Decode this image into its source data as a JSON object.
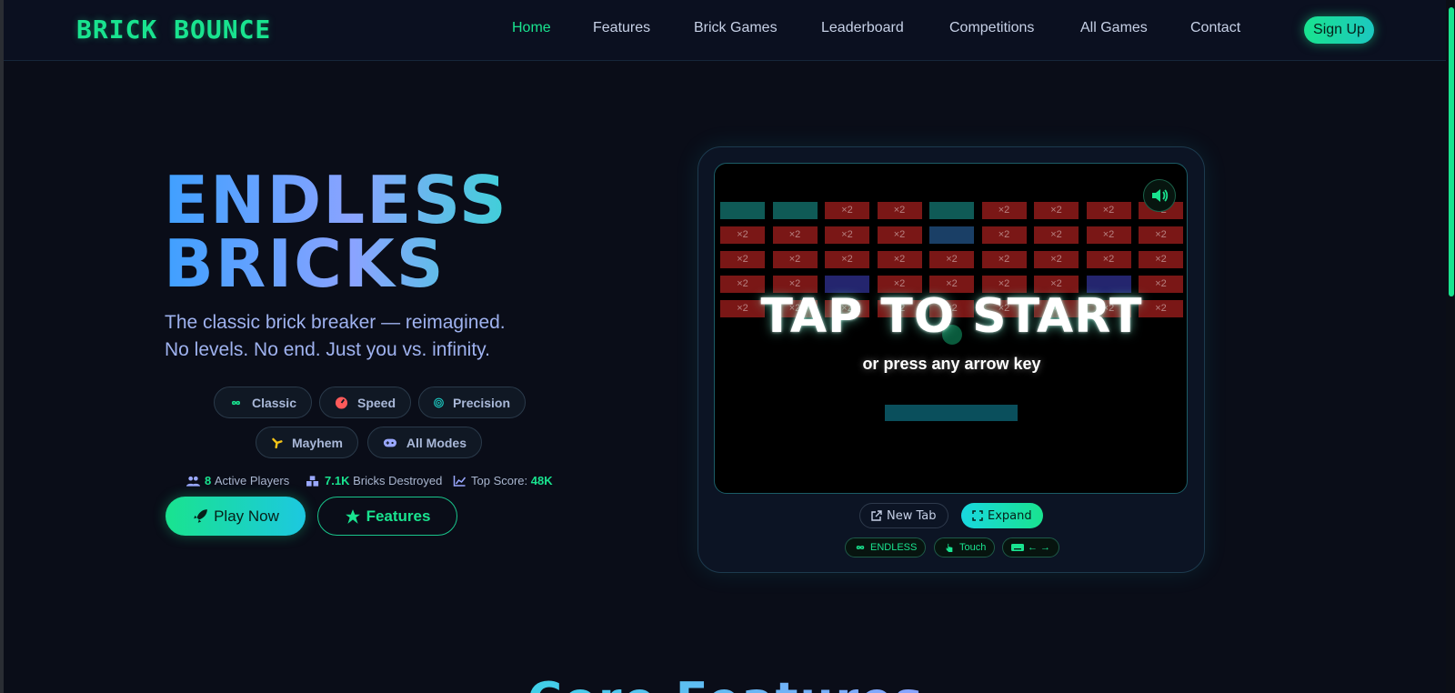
{
  "nav": {
    "brand": "BRICK BOUNCE",
    "links": [
      "Home",
      "Features",
      "Brick Games",
      "Leaderboard",
      "Competitions",
      "All Games",
      "Contact"
    ],
    "active": "Home",
    "signup": "Sign Up"
  },
  "hero": {
    "title_line1": "ENDLESS",
    "title_line2": "BRICKS",
    "subtitle_line1": "The classic brick breaker — reimagined.",
    "subtitle_line2": "No levels. No end. Just you vs. infinity.",
    "modes": [
      {
        "label": "Classic",
        "icon": "infinity-icon",
        "color": "#19e38f"
      },
      {
        "label": "Speed",
        "icon": "gauge-icon",
        "color": "#ff5a5a"
      },
      {
        "label": "Precision",
        "icon": "target-icon",
        "color": "#1cc8c0"
      },
      {
        "label": "Mayhem",
        "icon": "nuclear-icon",
        "color": "#f5c518"
      },
      {
        "label": "All Modes",
        "icon": "gamepad-icon",
        "color": "#9aa8ff"
      }
    ],
    "stats": {
      "active_players_value": "8",
      "active_players_label": "Active Players",
      "bricks_value": "7.1K",
      "bricks_label": "Bricks Destroyed",
      "top_score_label": "Top Score:",
      "top_score_value": "48K"
    },
    "play_button": "Play Now",
    "features_button": "Features"
  },
  "game": {
    "tap_to_start": "TAP TO START",
    "press_key": "or press any arrow key",
    "brick_multiplier": "×2",
    "new_tab": "New Tab",
    "expand": "Expand",
    "tags": [
      "ENDLESS",
      "Touch",
      "← →"
    ]
  },
  "next_section_title": "Core Features",
  "colors": {
    "accent": "#19e38f",
    "background": "#0a0d18",
    "brick_red": "#7a1716",
    "brick_teal": "#0f5a56"
  }
}
